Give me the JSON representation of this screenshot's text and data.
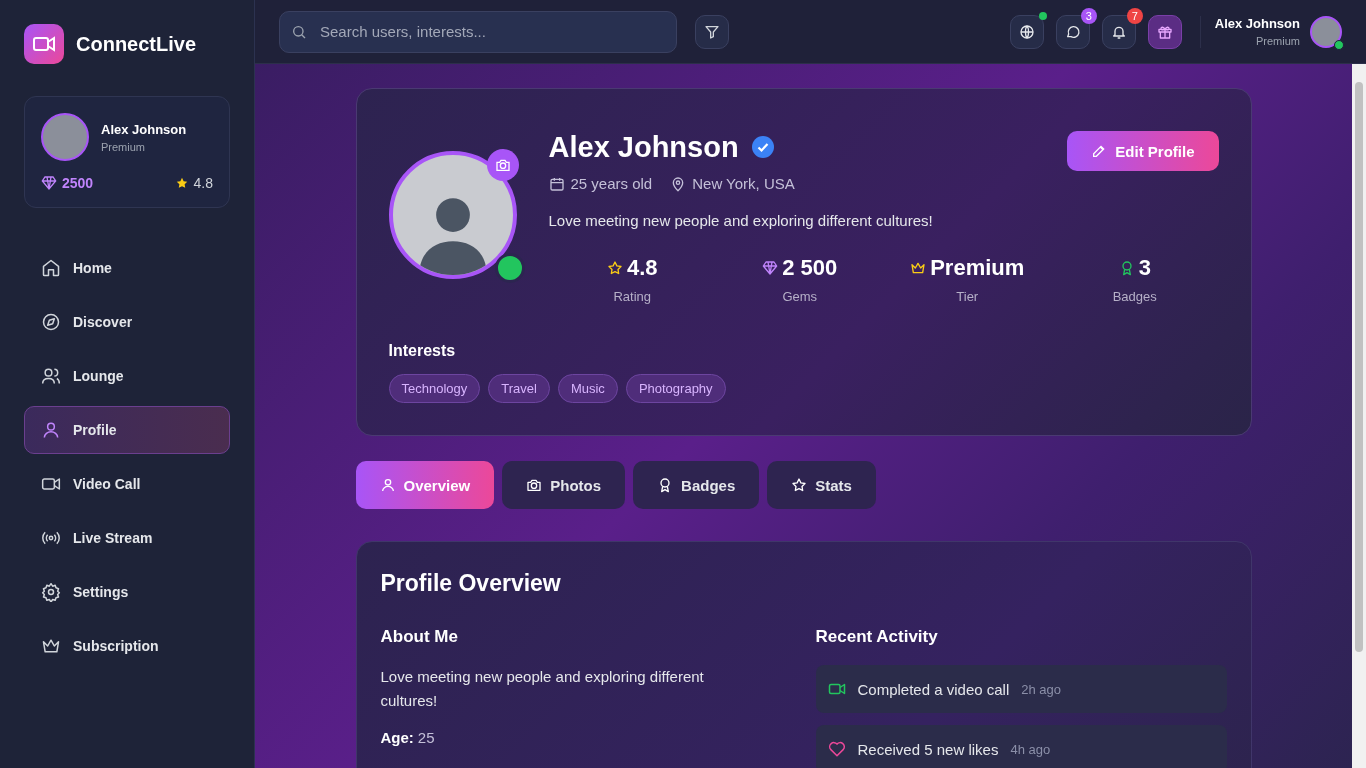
{
  "brand": {
    "name": "ConnectLive"
  },
  "sidebar": {
    "user": {
      "name": "Alex Johnson",
      "tier": "Premium",
      "gems": "2500",
      "rating": "4.8"
    },
    "items": [
      {
        "label": "Home",
        "selected": false
      },
      {
        "label": "Discover",
        "selected": false
      },
      {
        "label": "Lounge",
        "selected": false
      },
      {
        "label": "Profile",
        "selected": true
      },
      {
        "label": "Video Call",
        "selected": false
      },
      {
        "label": "Live Stream",
        "selected": false
      },
      {
        "label": "Settings",
        "selected": false
      },
      {
        "label": "Subscription",
        "selected": false
      }
    ]
  },
  "header": {
    "search": {
      "placeholder": "Search users, interests..."
    },
    "actions": [
      {
        "kind": "globe",
        "status_dot": true
      },
      {
        "kind": "chat",
        "badge": "3"
      },
      {
        "kind": "bell",
        "badge": "7"
      },
      {
        "kind": "gift"
      }
    ],
    "user": {
      "name": "Alex Johnson",
      "tier": "Premium",
      "online": true
    }
  },
  "profile": {
    "name": "Alex Johnson",
    "verified": true,
    "online": true,
    "age": "25 years old",
    "location": "New York, USA",
    "bio": "Love meeting new people and exploring different cultures!",
    "edit_button": "Edit Profile",
    "stats": [
      {
        "kind": "rating",
        "value": "4.8",
        "label": "Rating"
      },
      {
        "kind": "gems",
        "value": "2 500",
        "label": "Gems"
      },
      {
        "kind": "tier",
        "value": "Premium",
        "label": "Tier"
      },
      {
        "kind": "badges",
        "value": "3",
        "label": "Badges"
      }
    ],
    "interests_title": "Interests",
    "interests": [
      "Technology",
      "Travel",
      "Music",
      "Photography"
    ]
  },
  "tabs": [
    {
      "kind": "person",
      "label": "Overview",
      "selected": true
    },
    {
      "kind": "camera",
      "label": "Photos",
      "selected": false
    },
    {
      "kind": "badge",
      "label": "Badges",
      "selected": false
    },
    {
      "kind": "star",
      "label": "Stats",
      "selected": false
    }
  ],
  "overview": {
    "title": "Profile Overview",
    "about_title": "About Me",
    "about_text": "Love meeting new people and exploring different cultures!",
    "age_label": "Age:",
    "age_value": "25",
    "activity_title": "Recent Activity",
    "activities": [
      {
        "kind": "video_call",
        "text": "Completed a video call",
        "time": "2h ago"
      },
      {
        "kind": "like",
        "text": "Received 5 new likes",
        "time": "4h ago"
      }
    ]
  }
}
